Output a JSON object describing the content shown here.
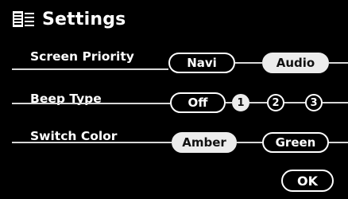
{
  "header": {
    "title": "Settings",
    "icon": "settings-list-icon"
  },
  "screen_priority": {
    "label": "Screen Priority",
    "options": [
      "Navi",
      "Audio"
    ],
    "selected": "Audio"
  },
  "beep_type": {
    "label": "Beep Type",
    "options": [
      "Off",
      "1",
      "2",
      "3"
    ],
    "selected": "1"
  },
  "switch_color": {
    "label": "Switch Color",
    "options": [
      "Amber",
      "Green"
    ],
    "selected": "Amber"
  },
  "ok_button": {
    "label": "OK"
  },
  "colors": {
    "background": "#000000",
    "foreground": "#ffffff",
    "selected_fill": "#ececec"
  }
}
